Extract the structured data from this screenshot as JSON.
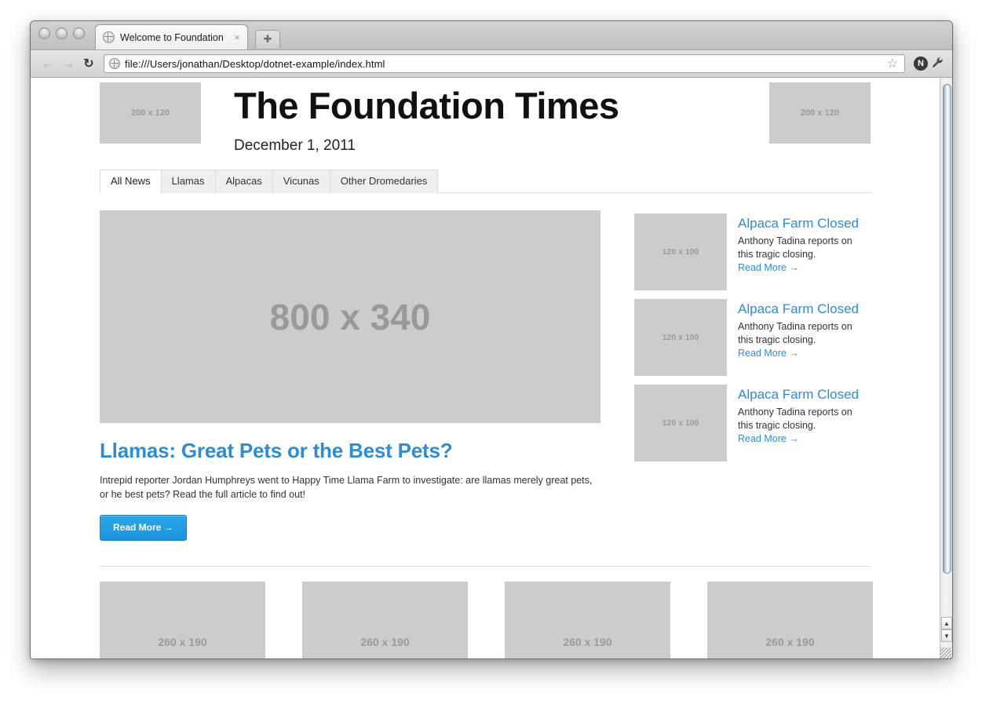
{
  "browser": {
    "tab": {
      "title": "Welcome to Foundation",
      "favicon_icon": "globe-icon",
      "close_icon": "×"
    },
    "new_tab_label": "✚",
    "nav": {
      "back_icon": "←",
      "forward_icon": "→",
      "reload_icon": "↻"
    },
    "url": "file:///Users/jonathan/Desktop/dotnet-example/index.html",
    "bookmark_icon": "☆",
    "profile_initial": "N",
    "wrench_icon": "🔧"
  },
  "page": {
    "masthead": {
      "left_ad": "200 x 120",
      "title": "The Foundation Times",
      "date": "December 1, 2011",
      "right_ad": "200 x 120"
    },
    "tabs": [
      {
        "label": "All News",
        "active": true
      },
      {
        "label": "Llamas",
        "active": false
      },
      {
        "label": "Alpacas",
        "active": false
      },
      {
        "label": "Vicunas",
        "active": false
      },
      {
        "label": "Other Dromedaries",
        "active": false
      }
    ],
    "lead": {
      "image": "800 x 340",
      "headline": "Llamas: Great Pets or the Best Pets?",
      "body": "Intrepid reporter Jordan Humphreys went to Happy Time Llama Farm to investigate: are llamas merely great pets, or he best pets? Read the full article to find out!",
      "button_label": "Read More →"
    },
    "sidebar": [
      {
        "thumb": "120 x 100",
        "title": "Alpaca Farm Closed",
        "desc": "Anthony Tadina reports on this tragic closing.",
        "link": "Read More →"
      },
      {
        "thumb": "120 x 100",
        "title": "Alpaca Farm Closed",
        "desc": "Anthony Tadina reports on this tragic closing.",
        "link": "Read More →"
      },
      {
        "thumb": "120 x 100",
        "title": "Alpaca Farm Closed",
        "desc": "Anthony Tadina reports on this tragic closing.",
        "link": "Read More →"
      }
    ],
    "bottom_strip": [
      {
        "label": "260 x 190"
      },
      {
        "label": "260 x 190"
      },
      {
        "label": "260 x 190"
      },
      {
        "label": "260 x 190"
      }
    ]
  },
  "scrollbar": {
    "up_arrow_icon": "▲",
    "down_arrow_icon": "▼"
  },
  "colors": {
    "link_blue": "#2c8cd8",
    "button_blue": "#1b93dd",
    "placeholder_bg": "#cccccc",
    "placeholder_text": "#999999"
  }
}
